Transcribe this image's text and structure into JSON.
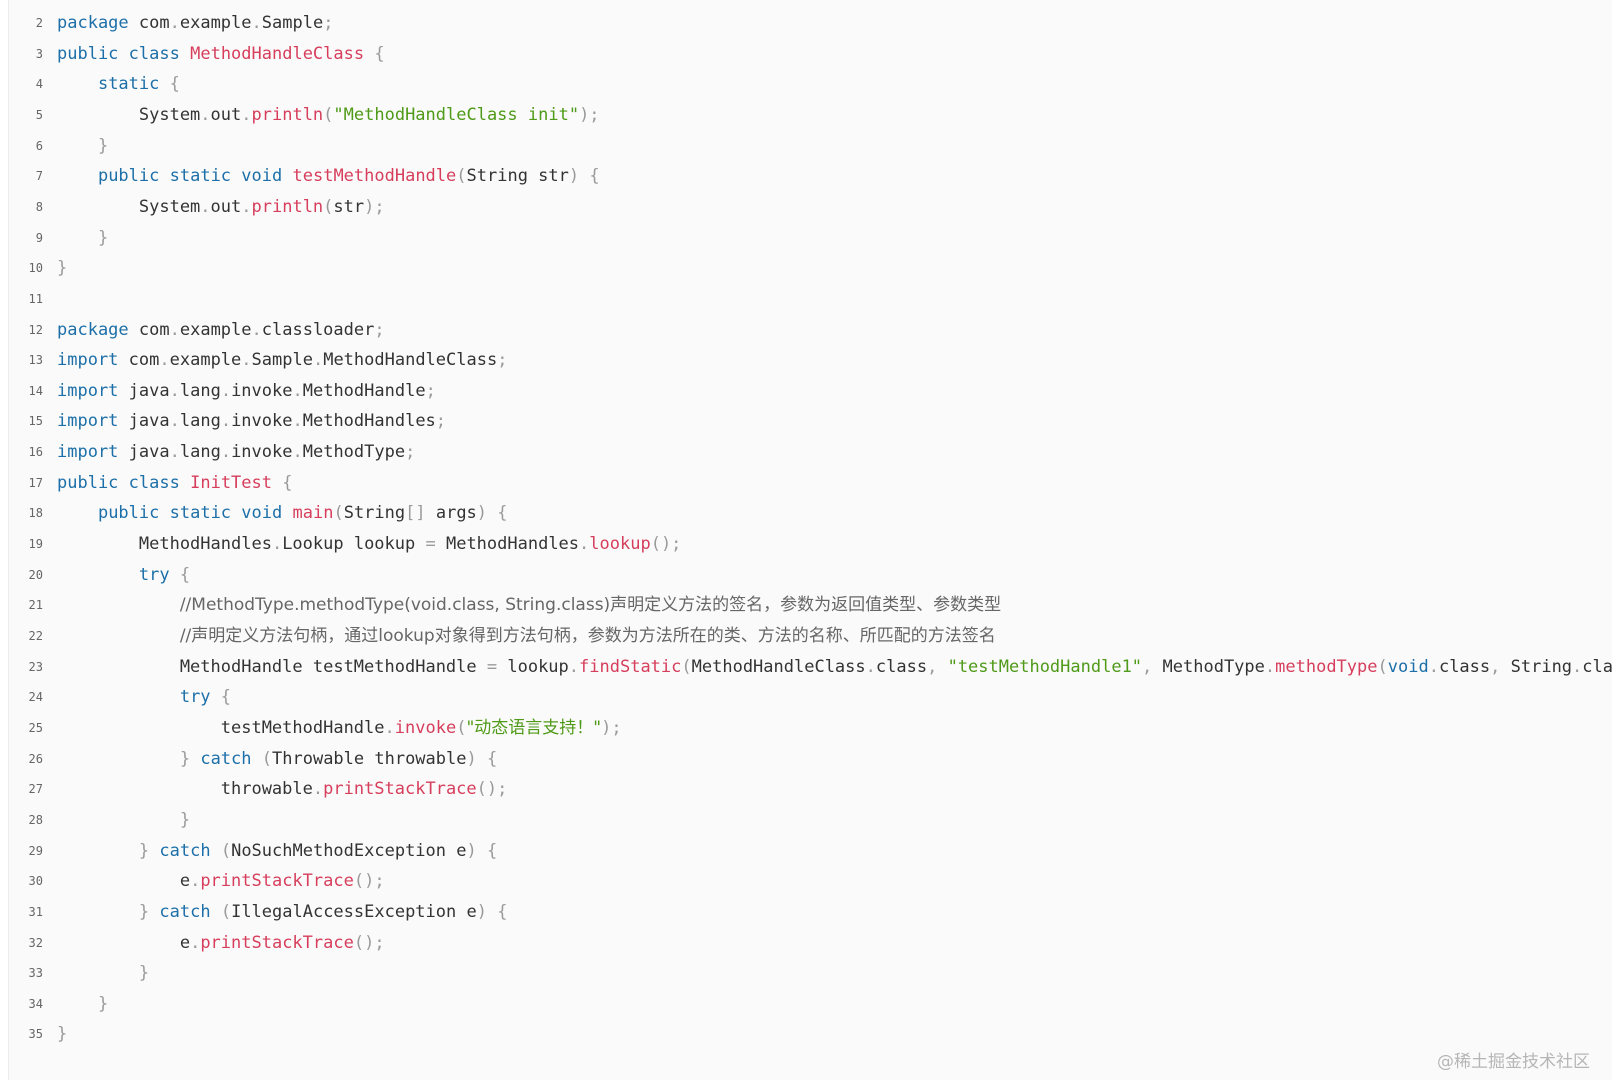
{
  "code_block": {
    "lines": [
      {
        "num": "2",
        "tokens": [
          [
            "kw",
            "package"
          ],
          [
            "plain",
            " com"
          ],
          [
            "punc",
            "."
          ],
          [
            "plain",
            "example"
          ],
          [
            "punc",
            "."
          ],
          [
            "plain",
            "Sample"
          ],
          [
            "punc",
            ";"
          ]
        ]
      },
      {
        "num": "3",
        "tokens": [
          [
            "kw",
            "public"
          ],
          [
            "plain",
            " "
          ],
          [
            "kw",
            "class"
          ],
          [
            "plain",
            " "
          ],
          [
            "fn",
            "MethodHandleClass"
          ],
          [
            "plain",
            " "
          ],
          [
            "punc",
            "{"
          ]
        ]
      },
      {
        "num": "4",
        "tokens": [
          [
            "plain",
            "    "
          ],
          [
            "kw",
            "static"
          ],
          [
            "plain",
            " "
          ],
          [
            "punc",
            "{"
          ]
        ]
      },
      {
        "num": "5",
        "tokens": [
          [
            "plain",
            "        System"
          ],
          [
            "punc",
            "."
          ],
          [
            "plain",
            "out"
          ],
          [
            "punc",
            "."
          ],
          [
            "fn",
            "println"
          ],
          [
            "punc",
            "("
          ],
          [
            "str",
            "\"MethodHandleClass init\""
          ],
          [
            "punc",
            ");"
          ]
        ]
      },
      {
        "num": "6",
        "tokens": [
          [
            "plain",
            "    "
          ],
          [
            "punc",
            "}"
          ]
        ]
      },
      {
        "num": "7",
        "tokens": [
          [
            "plain",
            "    "
          ],
          [
            "kw",
            "public"
          ],
          [
            "plain",
            " "
          ],
          [
            "kw",
            "static"
          ],
          [
            "plain",
            " "
          ],
          [
            "kw",
            "void"
          ],
          [
            "plain",
            " "
          ],
          [
            "fn",
            "testMethodHandle"
          ],
          [
            "punc",
            "("
          ],
          [
            "plain",
            "String str"
          ],
          [
            "punc",
            ")"
          ],
          [
            "plain",
            " "
          ],
          [
            "punc",
            "{"
          ]
        ]
      },
      {
        "num": "8",
        "tokens": [
          [
            "plain",
            "        System"
          ],
          [
            "punc",
            "."
          ],
          [
            "plain",
            "out"
          ],
          [
            "punc",
            "."
          ],
          [
            "fn",
            "println"
          ],
          [
            "punc",
            "("
          ],
          [
            "plain",
            "str"
          ],
          [
            "punc",
            ");"
          ]
        ]
      },
      {
        "num": "9",
        "tokens": [
          [
            "plain",
            "    "
          ],
          [
            "punc",
            "}"
          ]
        ]
      },
      {
        "num": "10",
        "tokens": [
          [
            "punc",
            "}"
          ]
        ]
      },
      {
        "num": "11",
        "tokens": []
      },
      {
        "num": "12",
        "tokens": [
          [
            "kw",
            "package"
          ],
          [
            "plain",
            " com"
          ],
          [
            "punc",
            "."
          ],
          [
            "plain",
            "example"
          ],
          [
            "punc",
            "."
          ],
          [
            "plain",
            "classloader"
          ],
          [
            "punc",
            ";"
          ]
        ]
      },
      {
        "num": "13",
        "tokens": [
          [
            "kw",
            "import"
          ],
          [
            "plain",
            " com"
          ],
          [
            "punc",
            "."
          ],
          [
            "plain",
            "example"
          ],
          [
            "punc",
            "."
          ],
          [
            "plain",
            "Sample"
          ],
          [
            "punc",
            "."
          ],
          [
            "plain",
            "MethodHandleClass"
          ],
          [
            "punc",
            ";"
          ]
        ]
      },
      {
        "num": "14",
        "tokens": [
          [
            "kw",
            "import"
          ],
          [
            "plain",
            " java"
          ],
          [
            "punc",
            "."
          ],
          [
            "plain",
            "lang"
          ],
          [
            "punc",
            "."
          ],
          [
            "plain",
            "invoke"
          ],
          [
            "punc",
            "."
          ],
          [
            "plain",
            "MethodHandle"
          ],
          [
            "punc",
            ";"
          ]
        ]
      },
      {
        "num": "15",
        "tokens": [
          [
            "kw",
            "import"
          ],
          [
            "plain",
            " java"
          ],
          [
            "punc",
            "."
          ],
          [
            "plain",
            "lang"
          ],
          [
            "punc",
            "."
          ],
          [
            "plain",
            "invoke"
          ],
          [
            "punc",
            "."
          ],
          [
            "plain",
            "MethodHandles"
          ],
          [
            "punc",
            ";"
          ]
        ]
      },
      {
        "num": "16",
        "tokens": [
          [
            "kw",
            "import"
          ],
          [
            "plain",
            " java"
          ],
          [
            "punc",
            "."
          ],
          [
            "plain",
            "lang"
          ],
          [
            "punc",
            "."
          ],
          [
            "plain",
            "invoke"
          ],
          [
            "punc",
            "."
          ],
          [
            "plain",
            "MethodType"
          ],
          [
            "punc",
            ";"
          ]
        ]
      },
      {
        "num": "17",
        "tokens": [
          [
            "kw",
            "public"
          ],
          [
            "plain",
            " "
          ],
          [
            "kw",
            "class"
          ],
          [
            "plain",
            " "
          ],
          [
            "fn",
            "InitTest"
          ],
          [
            "plain",
            " "
          ],
          [
            "punc",
            "{"
          ]
        ]
      },
      {
        "num": "18",
        "tokens": [
          [
            "plain",
            "    "
          ],
          [
            "kw",
            "public"
          ],
          [
            "plain",
            " "
          ],
          [
            "kw",
            "static"
          ],
          [
            "plain",
            " "
          ],
          [
            "kw",
            "void"
          ],
          [
            "plain",
            " "
          ],
          [
            "fn",
            "main"
          ],
          [
            "punc",
            "("
          ],
          [
            "plain",
            "String"
          ],
          [
            "punc",
            "[]"
          ],
          [
            "plain",
            " args"
          ],
          [
            "punc",
            ")"
          ],
          [
            "plain",
            " "
          ],
          [
            "punc",
            "{"
          ]
        ]
      },
      {
        "num": "19",
        "tokens": [
          [
            "plain",
            "        MethodHandles"
          ],
          [
            "punc",
            "."
          ],
          [
            "plain",
            "Lookup lookup "
          ],
          [
            "punc",
            "="
          ],
          [
            "plain",
            " MethodHandles"
          ],
          [
            "punc",
            "."
          ],
          [
            "fn",
            "lookup"
          ],
          [
            "punc",
            "();"
          ]
        ]
      },
      {
        "num": "20",
        "tokens": [
          [
            "plain",
            "        "
          ],
          [
            "kw",
            "try"
          ],
          [
            "plain",
            " "
          ],
          [
            "punc",
            "{"
          ]
        ]
      },
      {
        "num": "21",
        "tokens": [
          [
            "plain",
            "            "
          ],
          [
            "cm",
            "//MethodType.methodType(void.class, String.class)声明定义方法的签名，参数为返回值类型、参数类型"
          ]
        ]
      },
      {
        "num": "22",
        "tokens": [
          [
            "plain",
            "            "
          ],
          [
            "cm",
            "//声明定义方法句柄，通过lookup对象得到方法句柄，参数为方法所在的类、方法的名称、所匹配的方法签名"
          ]
        ]
      },
      {
        "num": "23",
        "tokens": [
          [
            "plain",
            "            MethodHandle testMethodHandle "
          ],
          [
            "punc",
            "="
          ],
          [
            "plain",
            " lookup"
          ],
          [
            "punc",
            "."
          ],
          [
            "fn",
            "findStatic"
          ],
          [
            "punc",
            "("
          ],
          [
            "plain",
            "MethodHandleClass"
          ],
          [
            "punc",
            "."
          ],
          [
            "plain",
            "class"
          ],
          [
            "punc",
            ","
          ],
          [
            "plain",
            " "
          ],
          [
            "str",
            "\"testMethodHandle1\""
          ],
          [
            "punc",
            ","
          ],
          [
            "plain",
            " MethodType"
          ],
          [
            "punc",
            "."
          ],
          [
            "fn",
            "methodType"
          ],
          [
            "punc",
            "("
          ],
          [
            "kw",
            "void"
          ],
          [
            "punc",
            "."
          ],
          [
            "plain",
            "class"
          ],
          [
            "punc",
            ","
          ],
          [
            "plain",
            " String"
          ],
          [
            "punc",
            "."
          ],
          [
            "plain",
            "class"
          ],
          [
            "punc",
            "));"
          ]
        ]
      },
      {
        "num": "24",
        "tokens": [
          [
            "plain",
            "            "
          ],
          [
            "kw",
            "try"
          ],
          [
            "plain",
            " "
          ],
          [
            "punc",
            "{"
          ]
        ]
      },
      {
        "num": "25",
        "tokens": [
          [
            "plain",
            "                testMethodHandle"
          ],
          [
            "punc",
            "."
          ],
          [
            "fn",
            "invoke"
          ],
          [
            "punc",
            "("
          ],
          [
            "str",
            "\"动态语言支持！\""
          ],
          [
            "punc",
            ");"
          ]
        ]
      },
      {
        "num": "26",
        "tokens": [
          [
            "plain",
            "            "
          ],
          [
            "punc",
            "}"
          ],
          [
            "plain",
            " "
          ],
          [
            "kw",
            "catch"
          ],
          [
            "plain",
            " "
          ],
          [
            "punc",
            "("
          ],
          [
            "plain",
            "Throwable throwable"
          ],
          [
            "punc",
            ")"
          ],
          [
            "plain",
            " "
          ],
          [
            "punc",
            "{"
          ]
        ]
      },
      {
        "num": "27",
        "tokens": [
          [
            "plain",
            "                throwable"
          ],
          [
            "punc",
            "."
          ],
          [
            "fn",
            "printStackTrace"
          ],
          [
            "punc",
            "();"
          ]
        ]
      },
      {
        "num": "28",
        "tokens": [
          [
            "plain",
            "            "
          ],
          [
            "punc",
            "}"
          ]
        ]
      },
      {
        "num": "29",
        "tokens": [
          [
            "plain",
            "        "
          ],
          [
            "punc",
            "}"
          ],
          [
            "plain",
            " "
          ],
          [
            "kw",
            "catch"
          ],
          [
            "plain",
            " "
          ],
          [
            "punc",
            "("
          ],
          [
            "plain",
            "NoSuchMethodException e"
          ],
          [
            "punc",
            ")"
          ],
          [
            "plain",
            " "
          ],
          [
            "punc",
            "{"
          ]
        ]
      },
      {
        "num": "30",
        "tokens": [
          [
            "plain",
            "            e"
          ],
          [
            "punc",
            "."
          ],
          [
            "fn",
            "printStackTrace"
          ],
          [
            "punc",
            "();"
          ]
        ]
      },
      {
        "num": "31",
        "tokens": [
          [
            "plain",
            "        "
          ],
          [
            "punc",
            "}"
          ],
          [
            "plain",
            " "
          ],
          [
            "kw",
            "catch"
          ],
          [
            "plain",
            " "
          ],
          [
            "punc",
            "("
          ],
          [
            "plain",
            "IllegalAccessException e"
          ],
          [
            "punc",
            ")"
          ],
          [
            "plain",
            " "
          ],
          [
            "punc",
            "{"
          ]
        ]
      },
      {
        "num": "32",
        "tokens": [
          [
            "plain",
            "            e"
          ],
          [
            "punc",
            "."
          ],
          [
            "fn",
            "printStackTrace"
          ],
          [
            "punc",
            "();"
          ]
        ]
      },
      {
        "num": "33",
        "tokens": [
          [
            "plain",
            "        "
          ],
          [
            "punc",
            "}"
          ]
        ]
      },
      {
        "num": "34",
        "tokens": [
          [
            "plain",
            "    "
          ],
          [
            "punc",
            "}"
          ]
        ]
      },
      {
        "num": "35",
        "tokens": [
          [
            "punc",
            "}"
          ]
        ]
      }
    ]
  },
  "watermark": "@稀土掘金技术社区",
  "colors": {
    "keyword": "#1c6fa8",
    "function": "#d63e5c",
    "string": "#4f9a18",
    "punctuation": "#9a9a9a",
    "comment": "#666666",
    "text": "#333333",
    "background": "#fafafa"
  }
}
